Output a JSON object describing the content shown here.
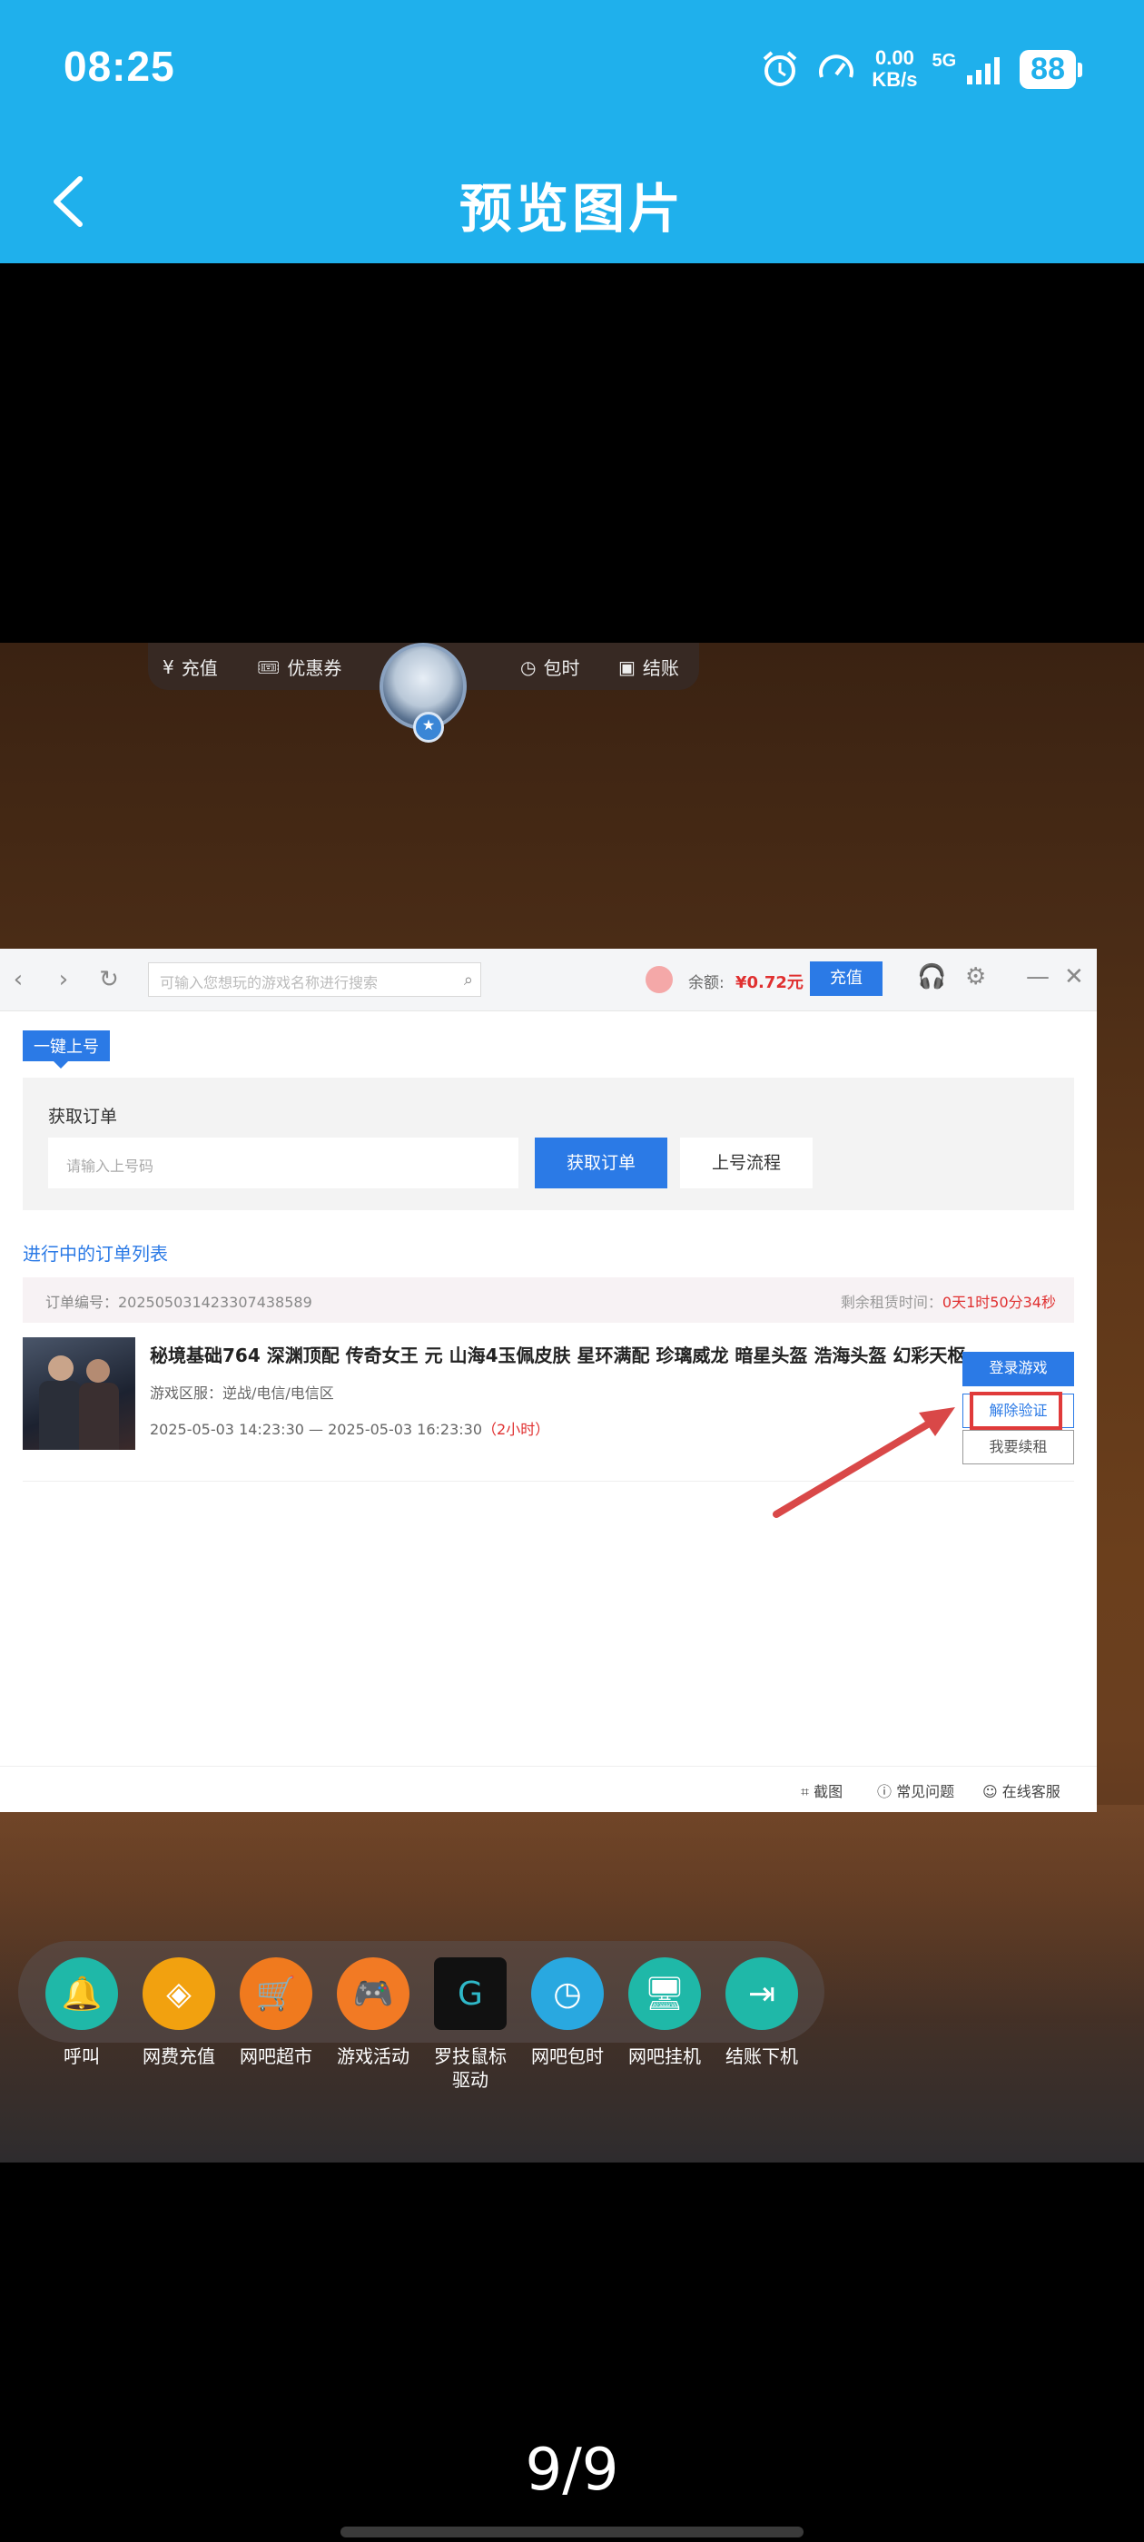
{
  "status_bar": {
    "time": "08:25",
    "speed_value": "0.00",
    "speed_unit": "KB/s",
    "network": "5G",
    "battery": "88"
  },
  "header": {
    "title": "预览图片"
  },
  "screenshot": {
    "top_menu": {
      "recharge": "充值",
      "coupon": "优惠券",
      "hourly": "包时",
      "checkout": "结账"
    },
    "app": {
      "search_placeholder": "可输入您想玩的游戏名称进行搜索",
      "balance_label": "余额:",
      "balance_value": "¥0.72元",
      "topup_button": "充值",
      "tab_onekey": "一键上号",
      "get_order_label": "获取订单",
      "order_input_placeholder": "请输入上号码",
      "get_order_button": "获取订单",
      "flow_button": "上号流程",
      "section_title": "进行中的订单列表",
      "order_no": "订单编号：20250503142330743858​9",
      "remaining_label": "剩余租赁时间：",
      "remaining_value": "0天1时50分34秒",
      "game_title": "秘境基础764 深渊顶配 传奇女王 元 山海4玉佩皮肤 星环满配 珍璃威龙 暗星头盔 浩海头盔 幻彩天枢",
      "game_zone": "游戏区服：逆战/电信/电信区",
      "game_time": "2025-05-03 14:23:30 — 2025-05-03 16:23:30",
      "game_duration": "（2小时）",
      "btn_login": "登录游戏",
      "btn_unlock": "解除验证",
      "btn_renew": "我要续租",
      "footer_screenshot": "截图",
      "footer_faq": "常见问题",
      "footer_service": "在线客服"
    },
    "dock": [
      {
        "label": "呼叫",
        "color": "#1fb8a8",
        "icon": "bell-icon"
      },
      {
        "label": "网费充值",
        "color": "#f2a10f",
        "icon": "coin-icon"
      },
      {
        "label": "网吧超市",
        "color": "#f07a1e",
        "icon": "cart-icon"
      },
      {
        "label": "游戏活动",
        "color": "#f27a24",
        "icon": "gamepad-icon"
      },
      {
        "label": "罗技鼠标驱动",
        "color": "#111111",
        "icon": "logitech-icon"
      },
      {
        "label": "网吧包时",
        "color": "#29a8e0",
        "icon": "clock-icon"
      },
      {
        "label": "网吧挂机",
        "color": "#1fb8a8",
        "icon": "monitor-icon"
      },
      {
        "label": "结账下机",
        "color": "#1fb8a8",
        "icon": "exit-icon"
      }
    ]
  },
  "page_indicator": "9/9"
}
